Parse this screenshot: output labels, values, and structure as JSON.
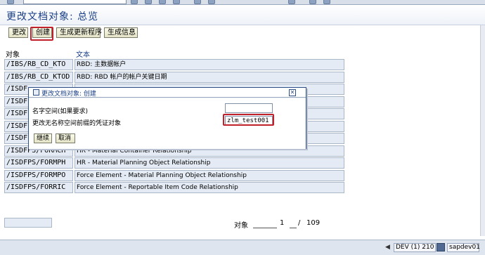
{
  "title": "更改文档对象: 总览",
  "toolbar": {
    "change_label": "更改",
    "create_label": "创建",
    "generate_label": "生成更新程序",
    "info_label": "生成信息"
  },
  "columns": {
    "object": "对象",
    "text": "文本"
  },
  "rows": [
    {
      "object": "/IBS/RB_CD_KTO",
      "text": "RBD: 主数据帐户"
    },
    {
      "object": "/IBS/RB_CD_KTOD",
      "text": "RBD: RBD 帐户的帐户关键日期"
    },
    {
      "object": "/ISDF",
      "text": ""
    },
    {
      "object": "/ISDF",
      "text": ""
    },
    {
      "object": "/ISDF",
      "text": ""
    },
    {
      "object": "/ISDF",
      "text": ""
    },
    {
      "object": "/ISDFPS/FORMC",
      "text": "Force Element - Material Container Relationship"
    },
    {
      "object": "/ISDFPS/FORMCH",
      "text": "HR - Material Container Relationship"
    },
    {
      "object": "/ISDFPS/FORMPH",
      "text": "HR - Material Planning Object Relationship"
    },
    {
      "object": "/ISDFPS/FORMPO",
      "text": "Force Element - Material Planning Object Relationship"
    },
    {
      "object": "/ISDFPS/FORRIC",
      "text": "Force Element - Reportable Item Code Relationship"
    }
  ],
  "pager": {
    "label": "对象",
    "current": "1",
    "separator": "/",
    "total": "109"
  },
  "statusbar": {
    "system": "DEV (1) 210",
    "host": "sapdev01"
  },
  "dialog": {
    "title": "更改文档对象: 创建",
    "namespace_label": "名字空间(如果要求)",
    "object_label": "更改无名称空间前缀的凭证对象",
    "namespace_value": "",
    "object_value": "zlm_test001",
    "continue_label": "继续",
    "cancel_label": "取消"
  },
  "colors": {
    "accent": "#1a3f86",
    "highlight": "#c0202a",
    "row_bg": "#e4ebf4"
  }
}
